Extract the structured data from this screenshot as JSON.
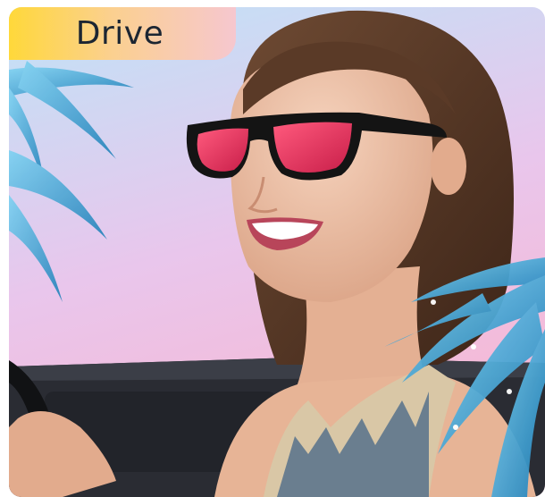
{
  "badge": {
    "label": "Drive"
  },
  "photo": {
    "sky_top": "#bfe3f7",
    "sky_bottom": "#f2b6d8",
    "lens_color": "#e8325d",
    "frame_color": "#141414",
    "palm_color": "#2f9fd6"
  }
}
